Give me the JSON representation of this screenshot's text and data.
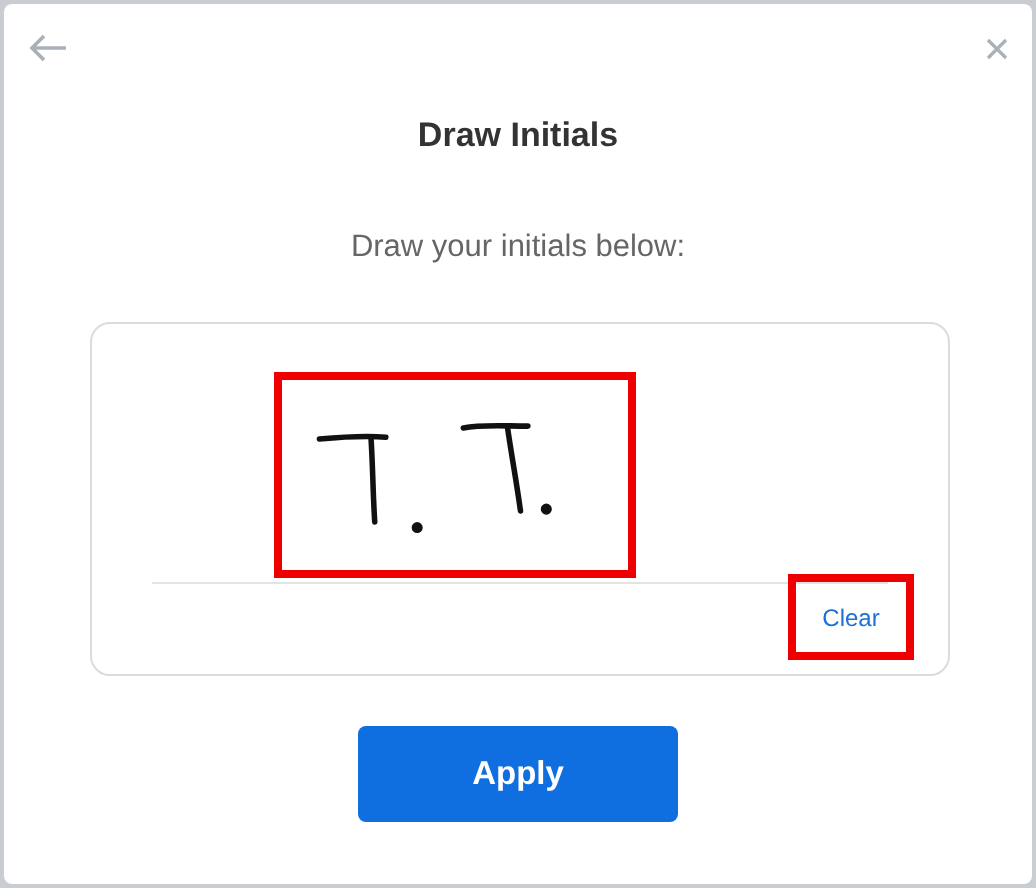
{
  "dialog": {
    "title": "Draw Initials",
    "subtitle": "Draw your initials below:"
  },
  "pad": {
    "drawing_highlighted": true,
    "clear": {
      "label": "Clear",
      "highlighted": true
    }
  },
  "apply_button": {
    "label": "Apply"
  }
}
